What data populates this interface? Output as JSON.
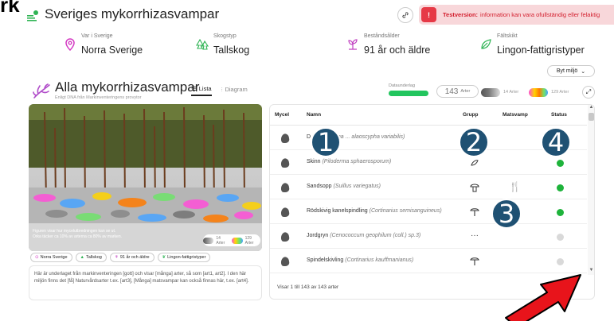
{
  "crop_text": "rk",
  "header": {
    "title": "Sveriges mykorrhizasvampar",
    "banner_bold": "Testversion:",
    "banner_text": "information kan vara ofullständig eller felaktig",
    "banner_icon": "!"
  },
  "filters": [
    {
      "label": "Var i Sverige",
      "value": "Norra Sverige",
      "icon": "location-pin"
    },
    {
      "label": "Skogstyp",
      "value": "Tallskog",
      "icon": "pine-tree"
    },
    {
      "label": "Beståndsålder",
      "value": "91 år och äldre",
      "icon": "sprout"
    },
    {
      "label": "Fältskikt",
      "value": "Lingon-fattigristyper",
      "icon": "leaf"
    }
  ],
  "env_button": "Byt miljö",
  "section": {
    "title": "Alla mykorrhizasvampar",
    "subtitle": "Enligt DNA från Markinventeringens provytor",
    "tab_list": "Lista",
    "tab_diagram": "Diagram"
  },
  "databasis_label": "Dataunderlag",
  "counts": {
    "main_value": "143",
    "main_unit": "Arter",
    "pill1_value": "14 Arter",
    "pill2_value": "129 Arter"
  },
  "image_panel": {
    "caption_line1": "Figuren visar hur mycelutbredningen kan se ut.",
    "caption_line2": "Orka täcker ca 10% av arterna ca 80% av marken.",
    "legend1": "14 Arter",
    "legend2": "129 Arter"
  },
  "tags": [
    "Norra Sverige",
    "Tallskog",
    "91 år och äldre",
    "Lingon-fattigristyper"
  ],
  "description": "Här är underlaget från markinventeringen [gott] och visar [många] arter, så som [art1, art2]. I den här miljön finns det [få] Naturvårdsarter t.ex. [art3], [Många] matsvampar kan också finnas här, t.ex. [art4].",
  "table": {
    "columns": [
      "Mycel",
      "Namn",
      "Grupp",
      "Matsvamp",
      "Status"
    ],
    "rows": [
      {
        "name": "D",
        "latin": "(Amphinema ... alaoscypha variabilis)",
        "group": "",
        "food": false,
        "status": "none"
      },
      {
        "name": "Skinn",
        "latin": "(Piloderma sphaerosporum)",
        "group": "crust",
        "food": false,
        "status": "green"
      },
      {
        "name": "Sandsopp",
        "latin": "(Suillus variegatus)",
        "group": "bolete",
        "food": true,
        "status": "green"
      },
      {
        "name": "Rödskivig kanelspindling",
        "latin": "(Cortinarius semisanguineus)",
        "group": "agaric",
        "food": false,
        "status": "green"
      },
      {
        "name": "Jordgryn",
        "latin": "(Cenococcum geophilum (coll.) sp.3)",
        "group": "other",
        "food": false,
        "status": "gray"
      },
      {
        "name": "Spindelskivling",
        "latin": "(Cortinarius kauffmanianus)",
        "group": "agaric",
        "food": false,
        "status": "gray"
      }
    ],
    "footer": "Visar 1 till 143 av 143 arter"
  },
  "badges": [
    "1",
    "2",
    "3",
    "4"
  ],
  "colors": {
    "accent_green": "#22c55e",
    "banner_red": "#e63946",
    "badge_blue": "#1f5173",
    "arrow_red": "#e8141b"
  }
}
